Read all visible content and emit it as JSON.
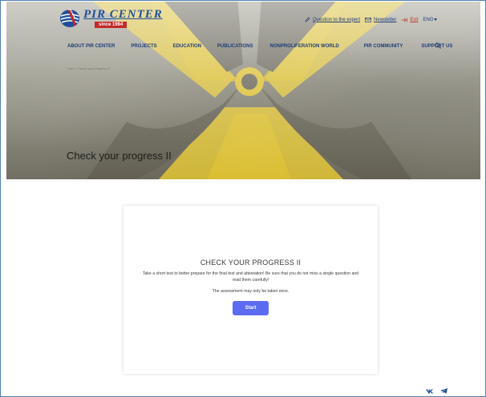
{
  "logo": {
    "name": "PIR CENTER",
    "since": "since 1994"
  },
  "toplinks": {
    "question": "Question to the expert",
    "newsletter": "Newsletter",
    "exit": "Exit",
    "lang": "ENG"
  },
  "nav": {
    "items": [
      "ABOUT PIR CENTER",
      "PROJECTS",
      "EDUCATION",
      "PUBLICATIONS",
      "NONPROLIFERATION WORLD",
      "PIR COMMUNITY",
      "SUPPORT US"
    ]
  },
  "breadcrumb": "Start > Check your progress II",
  "page_title": "Check your progress II",
  "card": {
    "title": "CHECK YOUR PROGRESS II",
    "description": "Take a short test to better prepare for the final test and attestation! Be sure that you do not miss a single question and read them carefully!",
    "note": "The assessment may only be taken once.",
    "start_label": "Start"
  },
  "colors": {
    "accent": "#5b6cf0",
    "brand_blue": "#1f4f9c",
    "brand_red": "#c62828",
    "symbol_yellow": "#e0c12a"
  }
}
